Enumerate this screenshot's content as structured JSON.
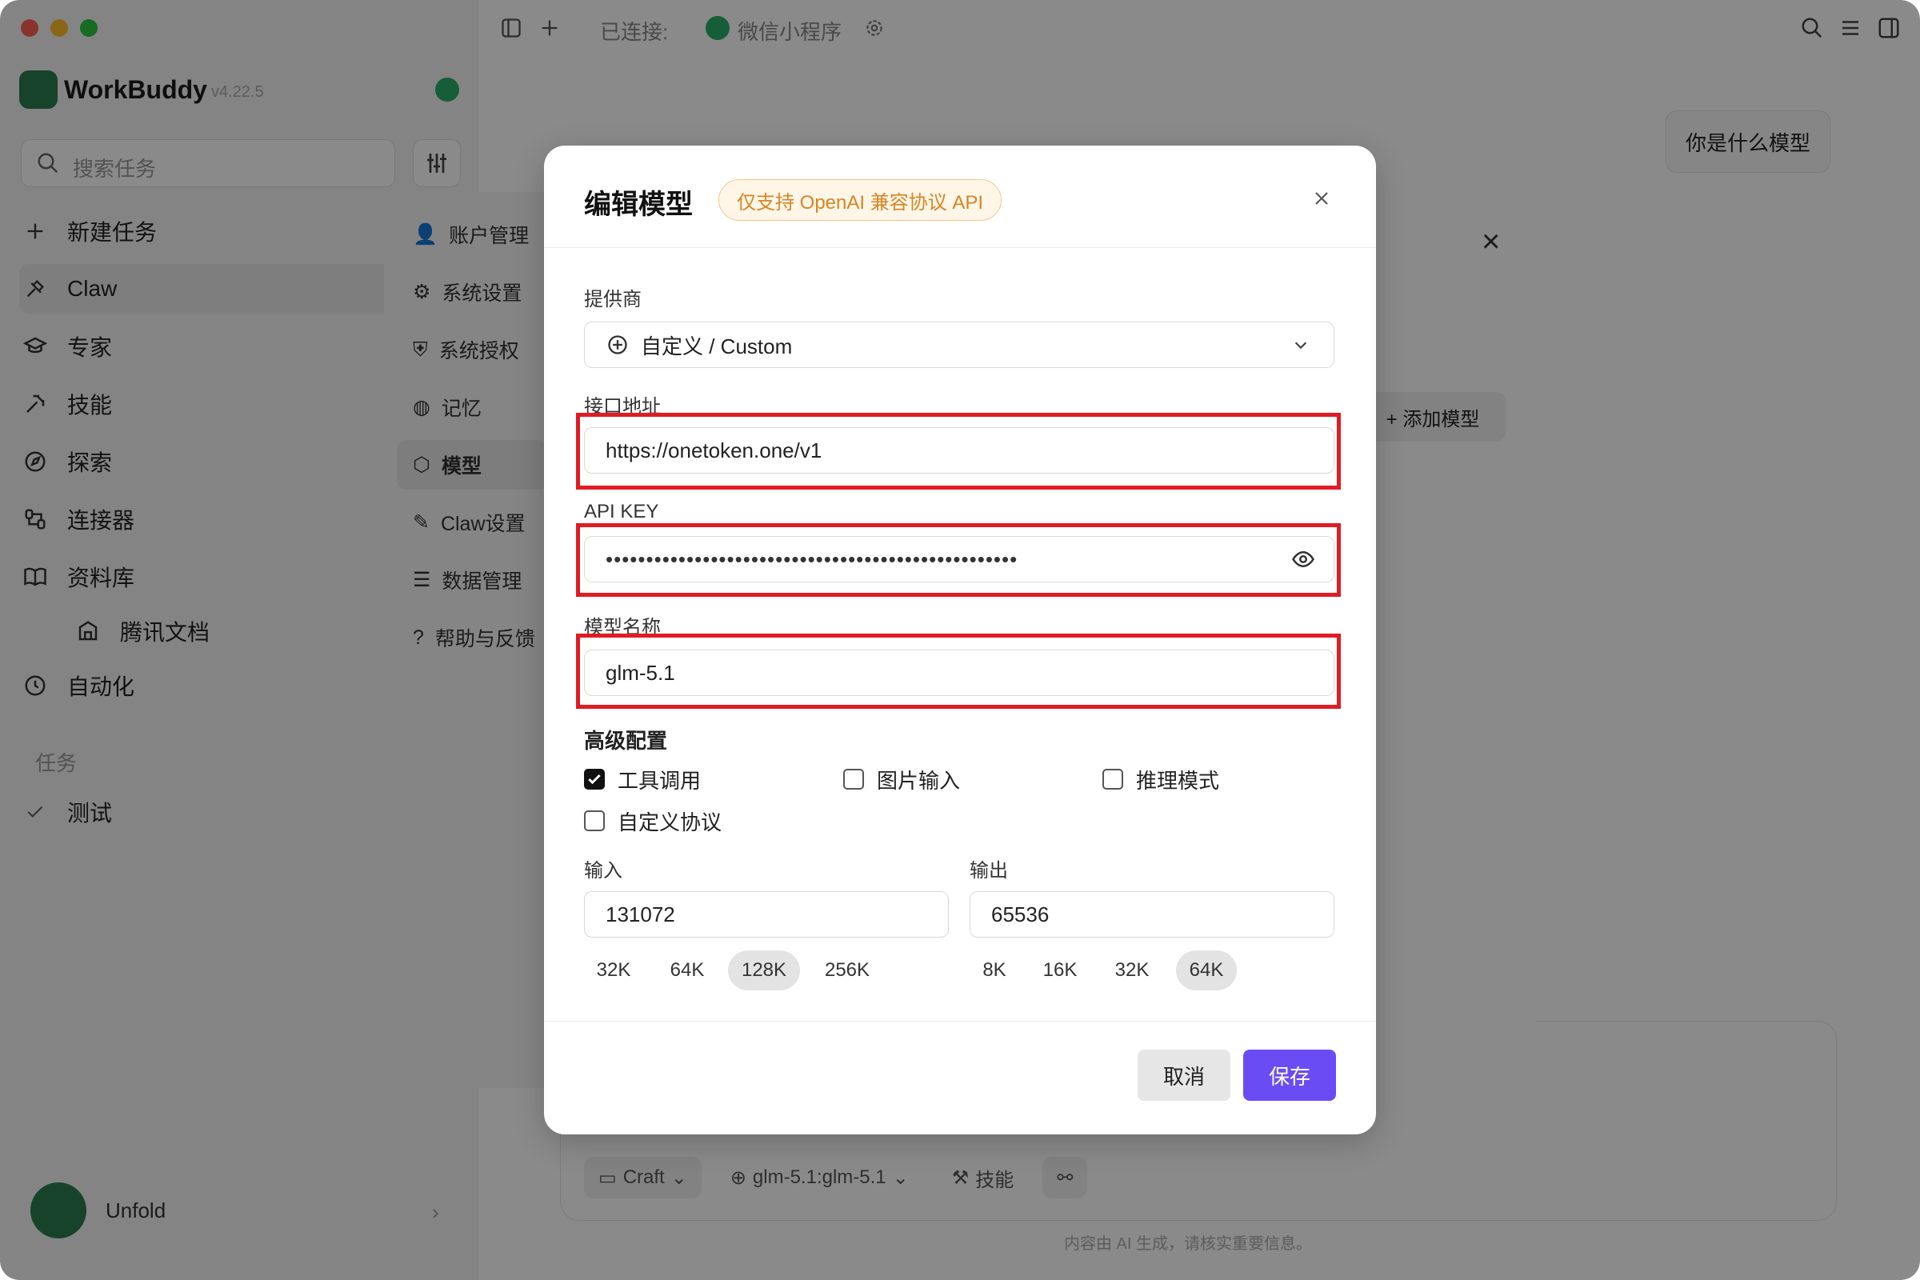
{
  "titlebar": {
    "connected_label": "已连接:",
    "connected_app": "微信小程序"
  },
  "sidebar": {
    "brand": "WorkBuddy",
    "version": "v4.22.5",
    "search_placeholder": "搜索任务",
    "items": [
      {
        "label": "新建任务",
        "icon": "plus-icon"
      },
      {
        "label": "Claw",
        "icon": "claw-icon"
      },
      {
        "label": "专家",
        "icon": "graduation-cap-icon"
      },
      {
        "label": "技能",
        "icon": "tools-icon"
      },
      {
        "label": "探索",
        "icon": "compass-icon"
      },
      {
        "label": "连接器",
        "icon": "connector-icon"
      },
      {
        "label": "资料库",
        "icon": "book-icon"
      },
      {
        "label": "腾讯文档",
        "icon": "docs-icon"
      },
      {
        "label": "自动化",
        "icon": "clock-icon"
      }
    ],
    "section_tasks": "任务",
    "tasks": [
      {
        "label": "测试"
      }
    ],
    "user_name": "Unfold"
  },
  "main": {
    "chat_chip": "你是什么模型",
    "composer": {
      "mode": "Craft",
      "model": "glm-5.1:glm-5.1",
      "skills": "技能"
    },
    "disclaimer": "内容由 AI 生成，请核实重要信息。"
  },
  "settings": {
    "nav": [
      {
        "label": "账户管理",
        "icon": "user-icon"
      },
      {
        "label": "系统设置",
        "icon": "gear-icon"
      },
      {
        "label": "系统授权",
        "icon": "shield-icon"
      },
      {
        "label": "记忆",
        "icon": "memory-icon"
      },
      {
        "label": "模型",
        "icon": "cube-icon"
      },
      {
        "label": "Claw设置",
        "icon": "claw-icon"
      },
      {
        "label": "数据管理",
        "icon": "database-icon"
      },
      {
        "label": "帮助与反馈",
        "icon": "help-icon"
      }
    ],
    "add_model": "+ 添加模型"
  },
  "modal": {
    "title": "编辑模型",
    "badge": "仅支持 OpenAI 兼容协议 API",
    "provider_label": "提供商",
    "provider_value": "自定义 / Custom",
    "endpoint_label": "接口地址",
    "endpoint_value": "https://onetoken.one/v1",
    "apikey_label": "API KEY",
    "apikey_value": "•••••••••••••••••••••••••••••••••••••••••••••••••••",
    "model_name_label": "模型名称",
    "model_name_value": "glm-5.1",
    "advanced_label": "高级配置",
    "options": [
      {
        "label": "工具调用",
        "checked": true
      },
      {
        "label": "图片输入",
        "checked": false
      },
      {
        "label": "推理模式",
        "checked": false
      },
      {
        "label": "自定义协议",
        "checked": false
      }
    ],
    "input_label": "输入",
    "input_value": "131072",
    "input_presets": [
      "32K",
      "64K",
      "128K",
      "256K"
    ],
    "input_selected": "128K",
    "output_label": "输出",
    "output_value": "65536",
    "output_presets": [
      "8K",
      "16K",
      "32K",
      "64K"
    ],
    "output_selected": "64K",
    "cancel": "取消",
    "save": "保存"
  },
  "colors": {
    "highlight": "#e01b24",
    "primary": "#6a4cf5",
    "badge_text": "#d98520"
  }
}
